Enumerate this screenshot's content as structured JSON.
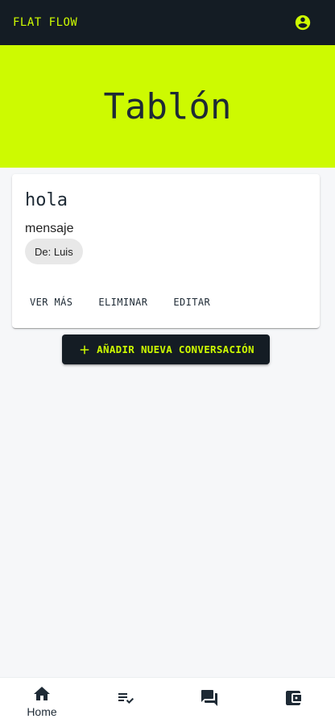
{
  "appbar": {
    "brand": "FLAT FLOW",
    "account_icon": "account-circle-icon",
    "brand_color": "#cdfa01",
    "background": "#141c24"
  },
  "hero": {
    "title": "Tablón",
    "background": "#cdfa01"
  },
  "card": {
    "title": "hola",
    "message": "mensaje",
    "chip": "De: Luis",
    "actions": {
      "view_more": "VER MÁS",
      "delete": "ELIMINAR",
      "edit": "EDITAR"
    }
  },
  "add_button": {
    "label": "AÑADIR NUEVA CONVERSACIÓN",
    "icon": "plus-icon"
  },
  "bottom_nav": {
    "items": [
      {
        "icon": "home-icon",
        "label": "Home",
        "active": true
      },
      {
        "icon": "playlist-check-icon",
        "label": "",
        "active": false
      },
      {
        "icon": "forum-icon",
        "label": "",
        "active": false
      },
      {
        "icon": "wallet-icon",
        "label": "",
        "active": false
      }
    ]
  }
}
